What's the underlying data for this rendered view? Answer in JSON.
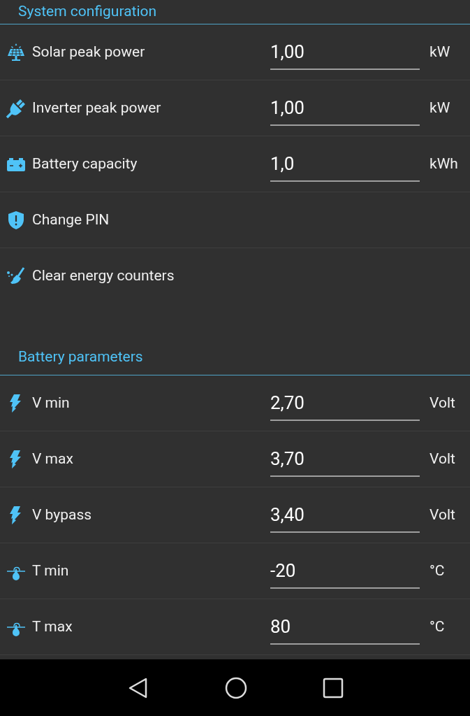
{
  "sections": [
    {
      "title": "System configuration",
      "rows": [
        {
          "kind": "field",
          "label": "Solar peak power",
          "value": "1,00",
          "unit": "kW"
        },
        {
          "kind": "field",
          "label": "Inverter peak power",
          "value": "1,00",
          "unit": "kW"
        },
        {
          "kind": "field",
          "label": "Battery capacity",
          "value": "1,0",
          "unit": "kWh"
        },
        {
          "kind": "action",
          "label": "Change PIN"
        },
        {
          "kind": "action",
          "label": "Clear energy counters"
        }
      ]
    },
    {
      "title": "Battery parameters",
      "rows": [
        {
          "kind": "field",
          "label": "V min",
          "value": "2,70",
          "unit": "Volt"
        },
        {
          "kind": "field",
          "label": "V max",
          "value": "3,70",
          "unit": "Volt"
        },
        {
          "kind": "field",
          "label": "V bypass",
          "value": "3,40",
          "unit": "Volt"
        },
        {
          "kind": "field",
          "label": "T min",
          "value": "-20",
          "unit": "°C"
        },
        {
          "kind": "field",
          "label": "T max",
          "value": "80",
          "unit": "°C"
        }
      ]
    }
  ]
}
